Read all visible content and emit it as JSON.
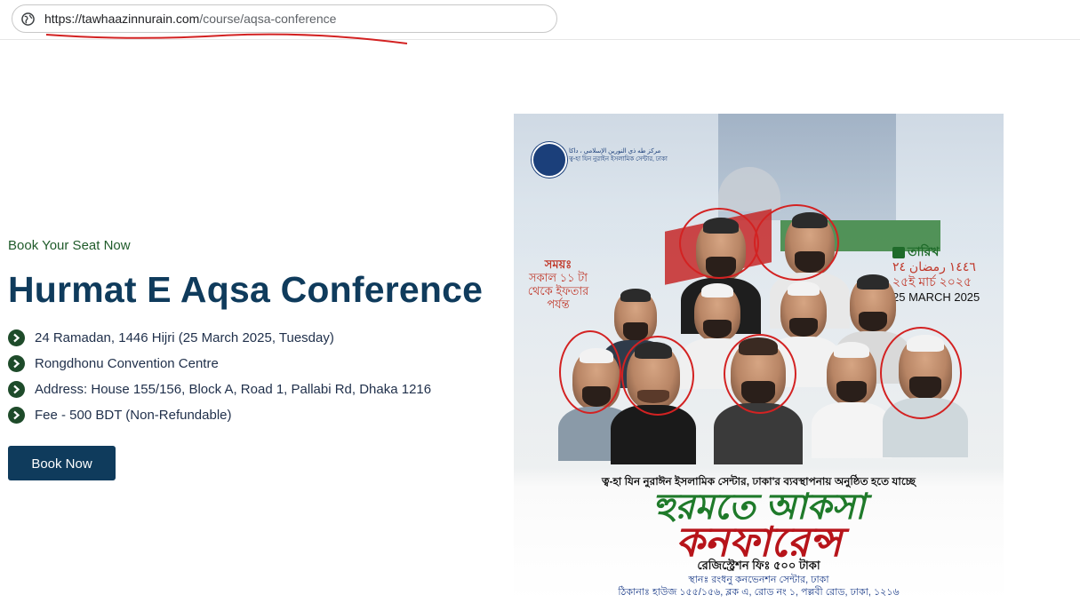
{
  "browser": {
    "url_host": "https://tawhaazinnurain.com",
    "url_path": "/course/aqsa-conference"
  },
  "hero": {
    "eyebrow": "Book Your Seat Now",
    "title": "Hurmat E Aqsa Conference",
    "details": [
      "24 Ramadan, 1446 Hijri (25 March 2025, Tuesday)",
      "Rongdhonu Convention Centre",
      "Address: House 155/156, Block A, Road 1, Pallabi Rd, Dhaka 1216",
      "Fee - 500 BDT (Non-Refundable)"
    ],
    "button_label": "Book Now"
  },
  "poster": {
    "org_name_ar": "مركز طه ذي النورين الإسلامي ، داكا",
    "org_name_bn": "ত্ব-হা যিন নুরাইন ইসলামিক সেন্টার, ঢাকা",
    "time_label": "সময়ঃ",
    "time_value": "সকাল ১১ টা থেকে ইফতার পর্যন্ত",
    "date_title": "তারিখ",
    "date_hijri": "١٤٤٦ رمضان ٢٤",
    "date_bn": "২৫ই মার্চ ২০২৫",
    "date_en": "25 MARCH 2025",
    "organizer_line": "ত্ব-হা যিন নুরাঈন ইসলামিক সেন্টার, ঢাকা'র ব্যবস্থাপনায় অনুষ্ঠিত হতে যাচ্ছে",
    "title_line1": "হুরমতে আকসা",
    "title_line2": "কনফারেন্স",
    "fee_line": "রেজিস্ট্রেশন ফিঃ ৫০০ টাকা",
    "venue_line": "স্থানঃ রংধনু কনভেনশন সেন্টার, ঢাকা",
    "address_line": "ঠিকানাঃ হাউজ ১৫৫/১৫৬, ব্লক এ, রোড নং ১, পল্লবী রোড, ঢাকা, ১২১৬"
  },
  "colors": {
    "primary": "#0f3b5c",
    "accent_green": "#1e4b2a",
    "markup_red": "#d32222"
  }
}
